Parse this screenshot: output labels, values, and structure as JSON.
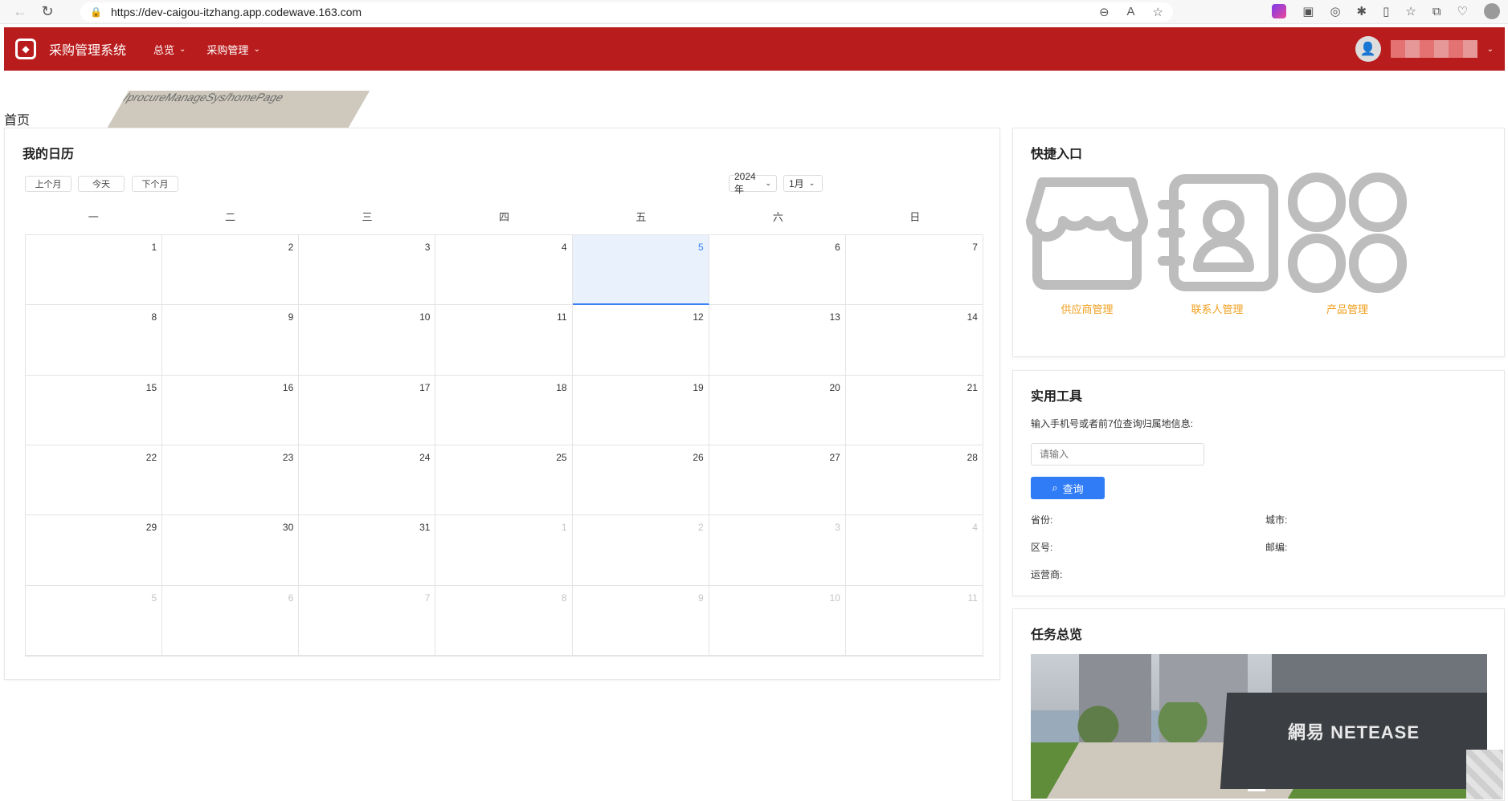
{
  "browser": {
    "url_host": "https://dev-caigou-itzhang.app.codewave.163.com",
    "url_path": "/procureManageSys/homePage"
  },
  "app": {
    "title": "采购管理系统",
    "menu": [
      "总览",
      "采购管理"
    ],
    "brand_color": "#b91c1c"
  },
  "breadcrumb": "首页",
  "calendar": {
    "title": "我的日历",
    "prev_label": "上个月",
    "today_label": "今天",
    "next_label": "下个月",
    "year_select": "2024 年",
    "month_select": "1月",
    "weekdays": [
      "一",
      "二",
      "三",
      "四",
      "五",
      "六",
      "日"
    ],
    "today": "5",
    "weeks": [
      [
        {
          "d": "1"
        },
        {
          "d": "2"
        },
        {
          "d": "3"
        },
        {
          "d": "4"
        },
        {
          "d": "5",
          "today": true
        },
        {
          "d": "6"
        },
        {
          "d": "7"
        }
      ],
      [
        {
          "d": "8"
        },
        {
          "d": "9"
        },
        {
          "d": "10"
        },
        {
          "d": "11"
        },
        {
          "d": "12"
        },
        {
          "d": "13"
        },
        {
          "d": "14"
        }
      ],
      [
        {
          "d": "15"
        },
        {
          "d": "16"
        },
        {
          "d": "17"
        },
        {
          "d": "18"
        },
        {
          "d": "19"
        },
        {
          "d": "20"
        },
        {
          "d": "21"
        }
      ],
      [
        {
          "d": "22"
        },
        {
          "d": "23"
        },
        {
          "d": "24"
        },
        {
          "d": "25"
        },
        {
          "d": "26"
        },
        {
          "d": "27"
        },
        {
          "d": "28"
        }
      ],
      [
        {
          "d": "29"
        },
        {
          "d": "30"
        },
        {
          "d": "31"
        },
        {
          "d": "1",
          "other": true
        },
        {
          "d": "2",
          "other": true
        },
        {
          "d": "3",
          "other": true
        },
        {
          "d": "4",
          "other": true
        }
      ],
      [
        {
          "d": "5",
          "other": true
        },
        {
          "d": "6",
          "other": true
        },
        {
          "d": "7",
          "other": true
        },
        {
          "d": "8",
          "other": true
        },
        {
          "d": "9",
          "other": true
        },
        {
          "d": "10",
          "other": true
        },
        {
          "d": "11",
          "other": true
        }
      ]
    ]
  },
  "quick": {
    "title": "快捷入口",
    "items": [
      {
        "label": "供应商管理",
        "icon": "store-icon"
      },
      {
        "label": "联系人管理",
        "icon": "contact-book-icon"
      },
      {
        "label": "产品管理",
        "icon": "grid-apps-icon"
      }
    ],
    "label_color": "#f0a020"
  },
  "tools": {
    "title": "实用工具",
    "description": "输入手机号或者前7位查询归属地信息:",
    "input_placeholder": "请输入",
    "query_label": "查询",
    "fields": {
      "province": "省份:",
      "city": "城市:",
      "area_code": "区号:",
      "postcode": "邮编:",
      "carrier": "运营商:"
    }
  },
  "tasks": {
    "title": "任务总览",
    "photo_text": "網易 NETEASE"
  }
}
